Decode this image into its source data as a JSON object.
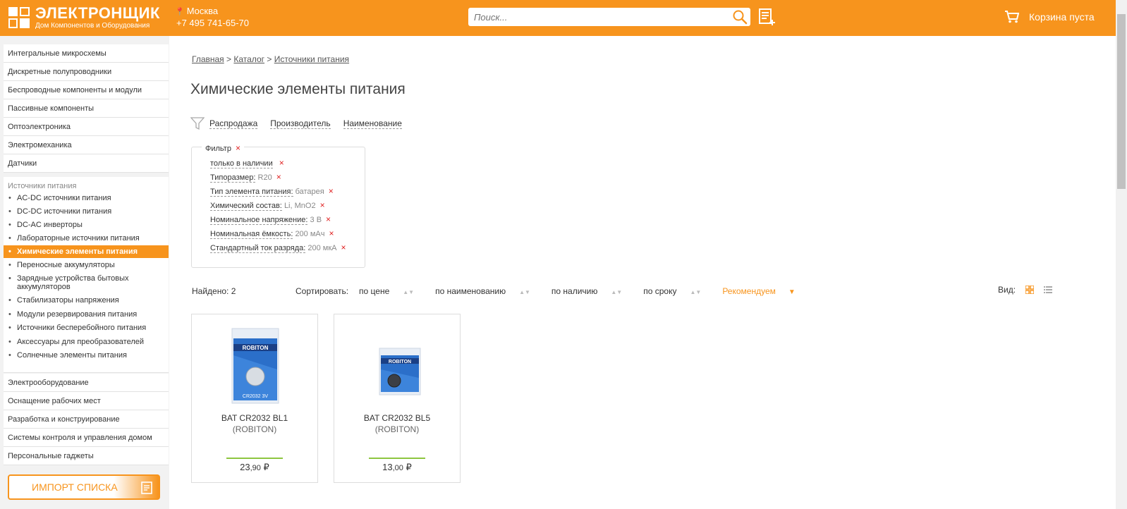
{
  "header": {
    "logo_name": "ЭЛЕКТРОНЩИК",
    "logo_sub": "Дом Компонентов и Оборудования",
    "city": "Москва",
    "phone": "+7 495 741-65-70",
    "search_placeholder": "Поиск...",
    "cart_label": "Корзина пуста",
    "accent": "#f7941d"
  },
  "sidebar": {
    "items_top": [
      "Интегральные микросхемы",
      "Дискретные полупроводники",
      "Беспроводные компоненты и модули",
      "Пассивные компоненты",
      "Оптоэлектроника",
      "Электромеханика",
      "Датчики"
    ],
    "section_title": "Источники питания",
    "sub_items": [
      "AC-DC источники питания",
      "DC-DC источники питания",
      "DC-AC инверторы",
      "Лабораторные источники питания",
      "Химические элементы питания",
      "Переносные аккумуляторы",
      "Зарядные устройства бытовых аккумуляторов",
      "Стабилизаторы напряжения",
      "Модули резервирования питания",
      "Источники бесперебойного питания",
      "Аксессуары для преобразователей",
      "Солнечные элементы питания"
    ],
    "active_sub_index": 4,
    "items_bottom": [
      "Электрооборудование",
      "Оснащение рабочих мест",
      "Разработка и конструирование",
      "Системы контроля и управления домом",
      "Персональные гаджеты"
    ],
    "import_label": "ИМПОРТ СПИСКА"
  },
  "breadcrumb": {
    "home": "Главная",
    "catalog": "Каталог",
    "current": "Источники питания",
    "sep": ">"
  },
  "page_title": "Химические элементы питания",
  "filter_links": [
    "Распродажа",
    "Производитель",
    "Наименование"
  ],
  "filter": {
    "legend": "Фильтр",
    "chips": [
      {
        "key": "только в наличии",
        "value": ""
      },
      {
        "key": "Типоразмер:",
        "value": "R20"
      },
      {
        "key": "Тип элемента питания:",
        "value": "батарея"
      },
      {
        "key": "Химический состав:",
        "value": "Li, MnO2"
      },
      {
        "key": "Номинальное напряжение:",
        "value": "3 В"
      },
      {
        "key": "Номинальная ёмкость:",
        "value": "200 мАч"
      },
      {
        "key": "Стандартный ток разряда:",
        "value": "200 мкА"
      }
    ],
    "remove": "×"
  },
  "results": {
    "found": "Найдено: 2",
    "sort_label": "Сортировать:",
    "sort_options": [
      "по цене",
      "по наименованию",
      "по наличию",
      "по сроку"
    ],
    "sort_active": "Рекомендуем",
    "view_label": "Вид:"
  },
  "products": [
    {
      "name": "BAT CR2032 BL1",
      "brand": "(ROBITON)",
      "price_int": "23",
      "price_dec": ",90",
      "currency": "₽"
    },
    {
      "name": "BAT CR2032 BL5",
      "brand": "(ROBITON)",
      "price_int": "13",
      "price_dec": ",00",
      "currency": "₽"
    }
  ]
}
